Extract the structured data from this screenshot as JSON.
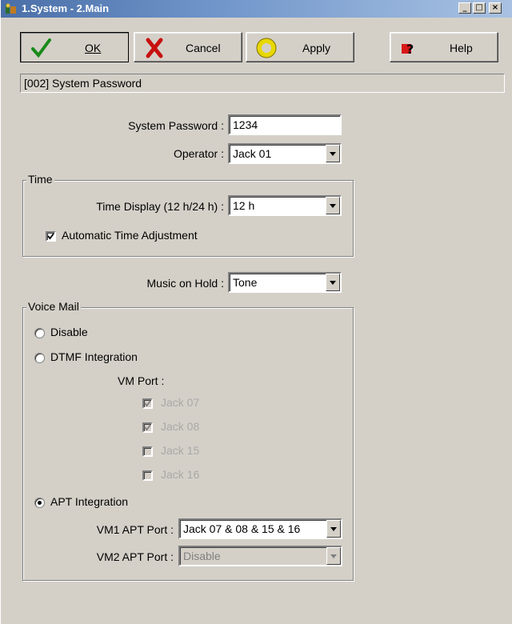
{
  "window": {
    "title": "1.System - 2.Main"
  },
  "toolbar": {
    "ok_label": "OK",
    "cancel_label": "Cancel",
    "apply_label": "Apply",
    "help_label": "Help",
    "icons": {
      "ok": "checkmark-icon",
      "cancel": "x-icon",
      "apply": "yellow-ring-icon",
      "help": "help-icon"
    }
  },
  "breadcrumb": "[002] System Password",
  "system_password": {
    "label": "System Password :",
    "value": "1234"
  },
  "operator": {
    "label": "Operator :",
    "value": "Jack 01"
  },
  "time_group": {
    "legend": "Time",
    "display_label": "Time Display (12 h/24 h) :",
    "display_value": "12 h",
    "auto_adjust_label": "Automatic Time Adjustment",
    "auto_adjust_checked": true
  },
  "music_on_hold": {
    "label": "Music on Hold :",
    "value": "Tone"
  },
  "voice_mail": {
    "legend": "Voice Mail",
    "options": [
      "Disable",
      "DTMF Integration",
      "APT Integration"
    ],
    "selected": "APT Integration",
    "vm_port_label": "VM Port :",
    "ports": [
      {
        "label": "Jack 07",
        "checked": true
      },
      {
        "label": "Jack 08",
        "checked": true
      },
      {
        "label": "Jack 15",
        "checked": false
      },
      {
        "label": "Jack 16",
        "checked": false
      }
    ],
    "vm1_label": "VM1 APT Port :",
    "vm1_value": "Jack 07 & 08 & 15 & 16",
    "vm2_label": "VM2 APT Port :",
    "vm2_value": "Disable"
  }
}
